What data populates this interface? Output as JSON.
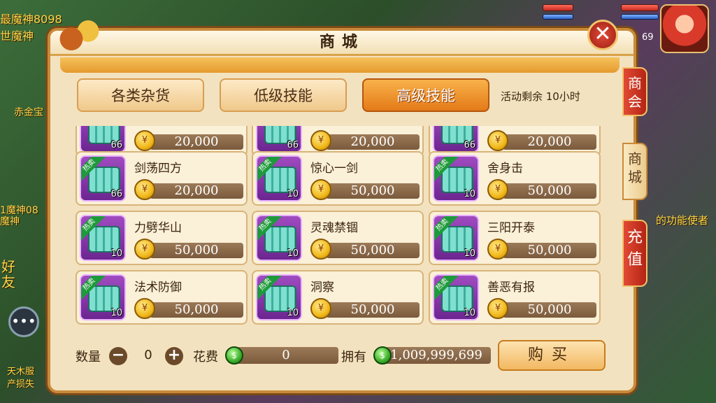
{
  "background": {
    "npc_labels": [
      "最魔神8098",
      "世魔神",
      "赤金宝",
      "1魔神08",
      "魔神",
      "的功能使者",
      "好友",
      "天木服",
      "产损失"
    ]
  },
  "player": {
    "level": "69"
  },
  "shop": {
    "title": "商城",
    "close_glyph": "✕",
    "side_tabs": [
      {
        "label": "商会",
        "style": "red"
      },
      {
        "label": "商城",
        "style": "cream"
      },
      {
        "label": "充值",
        "style": "red"
      }
    ],
    "category_tabs": [
      {
        "label": "各类杂货",
        "active": false
      },
      {
        "label": "低级技能",
        "active": false
      },
      {
        "label": "高级技能",
        "active": true
      }
    ],
    "event_remaining": "活动剩余 10小时",
    "hot_tag": "热卖",
    "coin_glyph": "¥",
    "items": [
      {
        "name": "",
        "qty": "66",
        "price": "20,000",
        "hot": false
      },
      {
        "name": "",
        "qty": "66",
        "price": "20,000",
        "hot": false
      },
      {
        "name": "",
        "qty": "66",
        "price": "20,000",
        "hot": false
      },
      {
        "name": "剑荡四方",
        "qty": "66",
        "price": "20,000",
        "hot": true
      },
      {
        "name": "惊心一剑",
        "qty": "10",
        "price": "50,000",
        "hot": true
      },
      {
        "name": "舍身击",
        "qty": "10",
        "price": "50,000",
        "hot": true
      },
      {
        "name": "力劈华山",
        "qty": "10",
        "price": "50,000",
        "hot": true
      },
      {
        "name": "灵魂禁锢",
        "qty": "10",
        "price": "50,000",
        "hot": true
      },
      {
        "name": "三阳开泰",
        "qty": "10",
        "price": "50,000",
        "hot": true
      },
      {
        "name": "法术防御",
        "qty": "10",
        "price": "50,000",
        "hot": true
      },
      {
        "name": "洞察",
        "qty": "10",
        "price": "50,000",
        "hot": true
      },
      {
        "name": "善恶有报",
        "qty": "10",
        "price": "50,000",
        "hot": true
      }
    ],
    "footer": {
      "quantity_label": "数量",
      "minus": "−",
      "plus": "+",
      "quantity": "0",
      "cost_label": "花费",
      "cost": "0",
      "owned_label": "拥有",
      "owned": "1,009,999,699",
      "buy_label": "购买"
    }
  }
}
